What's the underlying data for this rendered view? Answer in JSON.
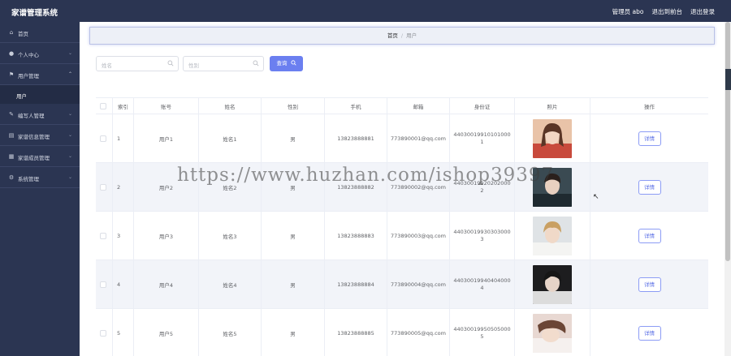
{
  "app": {
    "title": "家谱管理系统"
  },
  "topbar": {
    "user": "管理员 abo",
    "back_label": "退出到前台",
    "logout_label": "退出登录"
  },
  "sidebar": {
    "items": [
      {
        "label": "首页",
        "icon": "home-icon"
      },
      {
        "label": "个人中心",
        "icon": "user-icon"
      },
      {
        "label": "用户管理",
        "icon": "flag-icon",
        "children": [
          {
            "label": "用户"
          }
        ]
      },
      {
        "label": "编写人管理",
        "icon": "pen-icon"
      },
      {
        "label": "家谱信息管理",
        "icon": "list-icon"
      },
      {
        "label": "家谱成员管理",
        "icon": "grid-icon"
      },
      {
        "label": "系统管理",
        "icon": "settings-icon"
      }
    ]
  },
  "breadcrumb": {
    "home": "首页",
    "separator": "/",
    "current": "用户"
  },
  "search": {
    "name_placeholder": "姓名",
    "gender_placeholder": "性别",
    "button_label": "查询"
  },
  "table": {
    "columns": [
      "",
      "索引",
      "账号",
      "姓名",
      "性别",
      "手机",
      "邮箱",
      "身份证",
      "照片",
      "操作"
    ],
    "rows": [
      {
        "index": "1",
        "account": "用户1",
        "name": "姓名1",
        "gender": "男",
        "phone": "13823888881",
        "email": "773890001@qq.com",
        "id_card": "440300199101010001",
        "action": "详情"
      },
      {
        "index": "2",
        "account": "用户2",
        "name": "姓名2",
        "gender": "男",
        "phone": "13823888882",
        "email": "773890002@qq.com",
        "id_card": "440300199202020002",
        "action": "详情"
      },
      {
        "index": "3",
        "account": "用户3",
        "name": "姓名3",
        "gender": "男",
        "phone": "13823888883",
        "email": "773890003@qq.com",
        "id_card": "440300199303030003",
        "action": "详情"
      },
      {
        "index": "4",
        "account": "用户4",
        "name": "姓名4",
        "gender": "男",
        "phone": "13823888884",
        "email": "773890004@qq.com",
        "id_card": "440300199404040004",
        "action": "详情"
      },
      {
        "index": "5",
        "account": "用户5",
        "name": "姓名5",
        "gender": "男",
        "phone": "13823888885",
        "email": "773890005@qq.com",
        "id_card": "440300199505050005",
        "action": "详情"
      }
    ]
  },
  "watermark": "https://www.huzhan.com/ishop39397",
  "colors": {
    "sidebar_bg": "#2b3552",
    "accent": "#6b7ff0",
    "row_alt": "#f2f4f9"
  }
}
